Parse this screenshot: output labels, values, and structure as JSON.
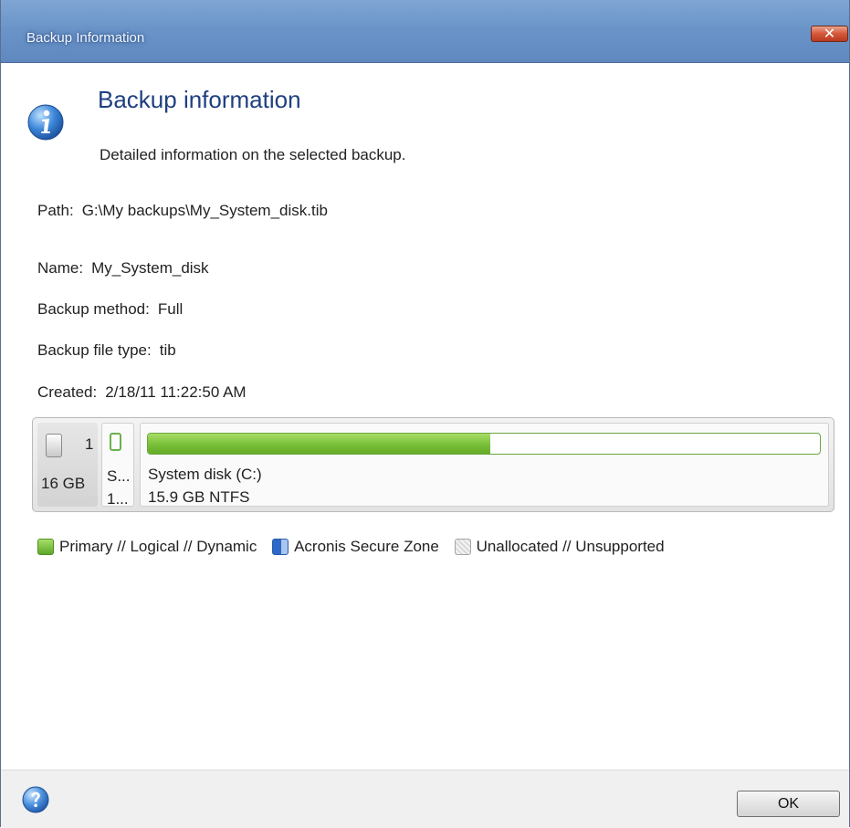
{
  "window": {
    "title": "Backup Information",
    "close_glyph": "✕"
  },
  "header": {
    "title": "Backup information",
    "subtitle": "Detailed information on the selected backup.",
    "icon": "info-icon"
  },
  "details": {
    "path_label": "Path:",
    "path_value": "G:\\My backups\\My_System_disk.tib",
    "name_label": "Name:",
    "name_value": "My_System_disk",
    "method_label": "Backup method:",
    "method_value": "Full",
    "filetype_label": "Backup file type:",
    "filetype_value": "tib",
    "created_label": "Created:",
    "created_value": "2/18/11 11:22:50 AM"
  },
  "disk": {
    "number": "1",
    "size": "16 GB",
    "small_partition": {
      "line1": "S...",
      "line2": "1..."
    },
    "partition": {
      "name": "System disk (C:)",
      "info": "15.9 GB  NTFS",
      "used_fraction": 0.51
    }
  },
  "legend": [
    {
      "label": "Primary // Logical // Dynamic",
      "swatch": "green"
    },
    {
      "label": "Acronis Secure Zone",
      "swatch": "blue"
    },
    {
      "label": "Unallocated // Unsupported",
      "swatch": "gray"
    }
  ],
  "footer": {
    "help_icon": "help-icon",
    "ok_label": "OK"
  },
  "colors": {
    "title_bar": "#6b95c9",
    "header_title": "#1e3f80",
    "partition_fill": "#7cc23b"
  }
}
